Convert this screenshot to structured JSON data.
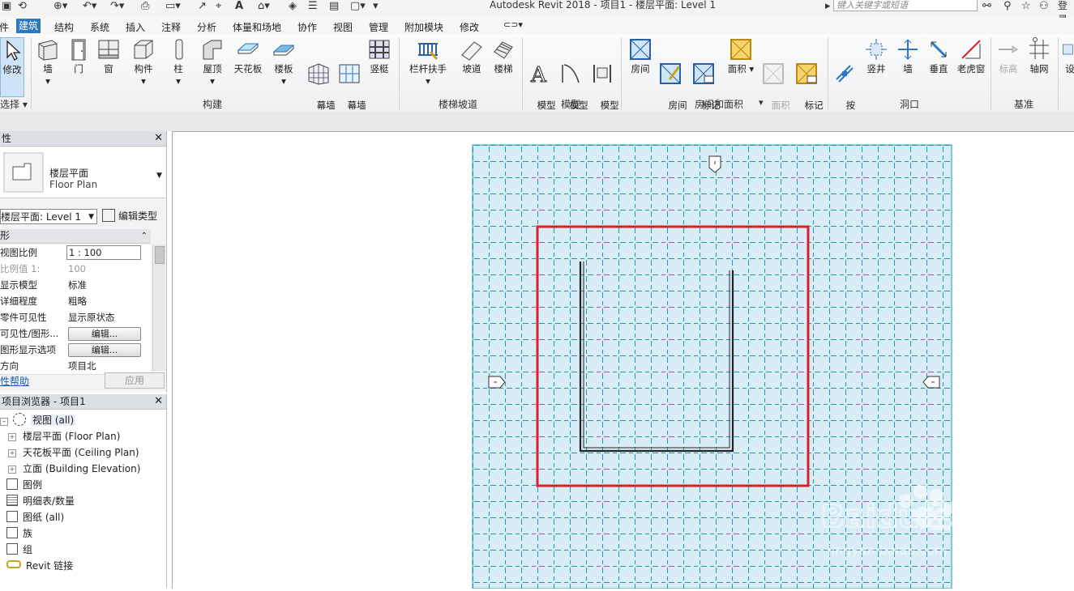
{
  "window": {
    "title": "Autodesk Revit 2018 -    项目1 - 楼层平面: Level 1",
    "search_placeholder": "键入关键字或短语",
    "login_label": "登录"
  },
  "menu": {
    "tabs": [
      "件",
      "建筑",
      "结构",
      "系统",
      "插入",
      "注释",
      "分析",
      "体量和场地",
      "协作",
      "视图",
      "管理",
      "附加模块",
      "修改"
    ],
    "active": "建筑"
  },
  "ribbon": {
    "modify": "修改",
    "select": "选择",
    "buttons": {
      "wall": "墙",
      "door": "门",
      "window": "窗",
      "component": "构件",
      "column": "柱",
      "roof": "屋顶",
      "ceiling": "天花板",
      "floor": "楼板",
      "curtain_system": "幕墙\n系统",
      "curtain_grid": "幕墙\n网格",
      "mullion": "竖梃",
      "railing": "栏杆扶手",
      "ramp": "坡道",
      "stair": "楼梯",
      "model_text": "模型\n文字",
      "model_line": "模型\n线",
      "model_group": "模型\n组",
      "room": "房间",
      "room_separator": "房间\n分隔",
      "tag_room": "标记\n房间",
      "area": "面积",
      "area_boundary": "面积\n边界",
      "tag_area": "标记\n面积",
      "by_face": "按\n面",
      "shaft": "竖井",
      "wall_opening": "墙",
      "vertical": "垂直",
      "dormer": "老虎窗",
      "level": "标高",
      "grid": "轴网",
      "set": "设"
    },
    "groups": {
      "build": "构建",
      "circulation": "楼梯坡道",
      "model": "模型",
      "room_area": "房间和面积",
      "opening": "洞口",
      "datum": "基准"
    }
  },
  "properties": {
    "title": "性",
    "type_name": "楼层平面",
    "type_name_en": "Floor Plan",
    "view_selector": "楼层平面: Level 1",
    "edit_type": "编辑类型",
    "section": "形",
    "rows": [
      {
        "key": "视图比例",
        "value": "1 : 100"
      },
      {
        "key": "比例值 1:",
        "value": "100"
      },
      {
        "key": "显示模型",
        "value": "标准"
      },
      {
        "key": "详细程度",
        "value": "粗略"
      },
      {
        "key": "零件可见性",
        "value": "显示原状态"
      },
      {
        "key": "可见性/图形...",
        "value": "编辑..."
      },
      {
        "key": "图形显示选项",
        "value": "编辑..."
      },
      {
        "key": "方向",
        "value": "项目北"
      }
    ],
    "help": "性帮助",
    "apply": "应用"
  },
  "browser": {
    "title": "项目浏览器 - 项目1",
    "items": [
      "视图 (all)",
      "楼层平面 (Floor Plan)",
      "天花板平面 (Ceiling Plan)",
      "立面 (Building Elevation)",
      "图例",
      "明细表/数量",
      "图纸 (all)",
      "族",
      "组",
      "Revit 链接"
    ]
  },
  "colors": {
    "accent": "#2b78c6",
    "grid_fill": "#d8ecf6",
    "grid_line": "#1a9ab8",
    "highlight": "#d8202a"
  },
  "watermark": {
    "brand": "Baidu经验",
    "url": "jingyan.baidu.com"
  }
}
